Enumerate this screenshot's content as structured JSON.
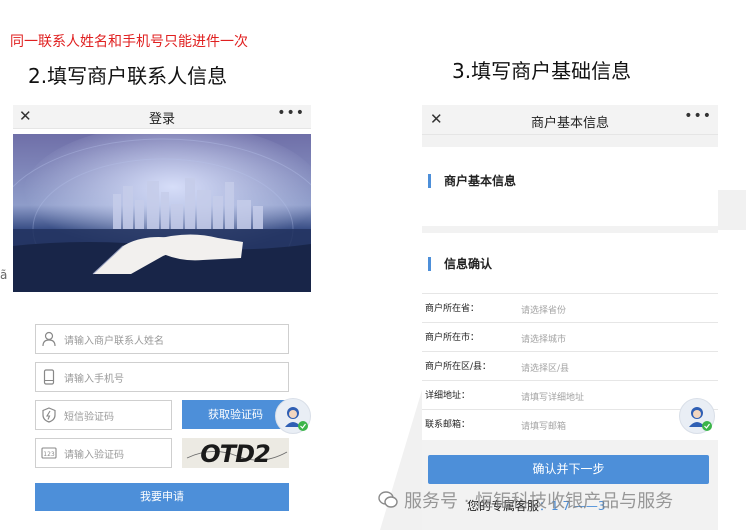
{
  "notes": {
    "red_note": "同一联系人姓名和手机号只能进件一次",
    "step2": "2.填写商户联系人信息",
    "step3": "3.填写商户基础信息"
  },
  "login_screen": {
    "title": "登录",
    "close_icon": "close-icon",
    "more_icon": "more-icon",
    "name_placeholder": "请输入商户联系人姓名",
    "phone_placeholder": "请输入手机号",
    "sms_placeholder": "短信验证码",
    "get_code_label": "获取验证码",
    "captcha_placeholder": "请输入验证码",
    "captcha_text": "OTD2",
    "apply_label": "我要申请"
  },
  "merchant_screen": {
    "title": "商户基本信息",
    "section1": "商户基本信息",
    "section2": "信息确认",
    "rows": [
      {
        "label": "商户所在省：",
        "value": "请选择省份"
      },
      {
        "label": "商户所在市：",
        "value": "请选择城市"
      },
      {
        "label": "商户所在区/县：",
        "value": "请选择区/县"
      },
      {
        "label": "详细地址：",
        "value": "请填写详细地址"
      },
      {
        "label": "联系邮箱：",
        "value": "请填写邮箱"
      }
    ],
    "next_label": "确认并下一步",
    "exclusive_label": "您的专属客服",
    "exclusive_number": "：1 7    ——3"
  },
  "watermark": "服务号 · 恒钜科技收银产品与服务",
  "edge_mark": "ã",
  "colors": {
    "accent": "#4d8fd9",
    "red": "#e02020"
  }
}
